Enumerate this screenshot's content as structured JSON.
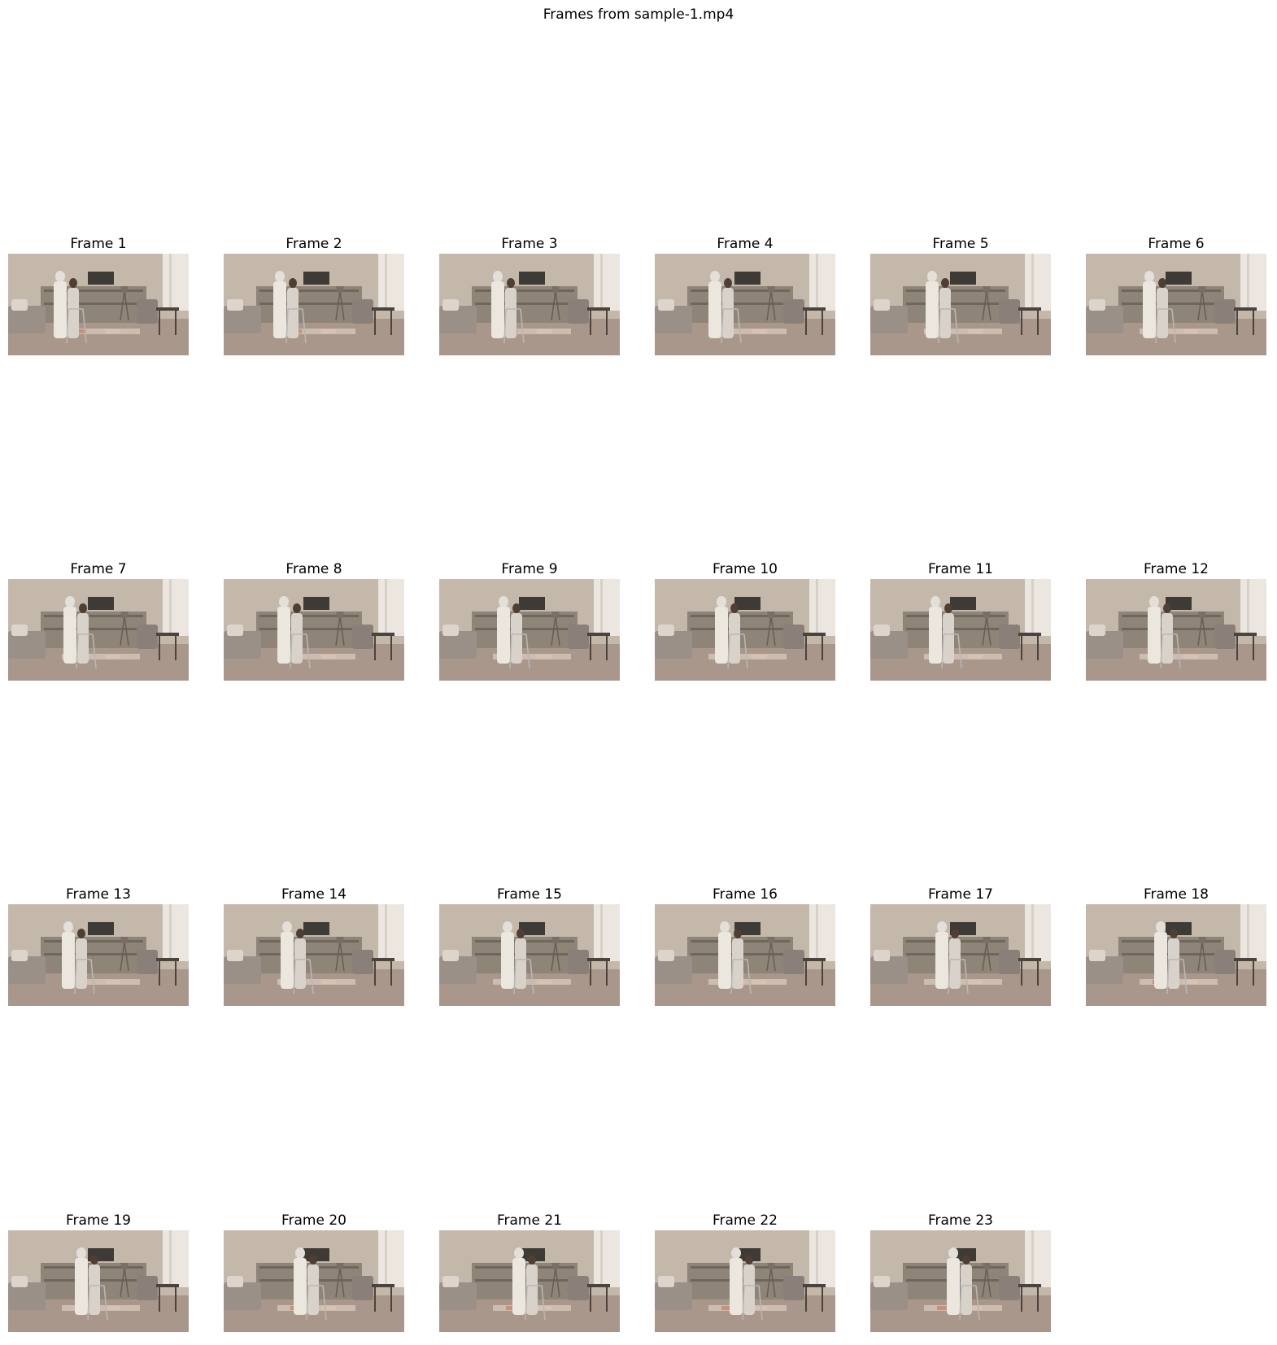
{
  "title": "Frames from sample-1.mp4",
  "frames": [
    {
      "label": "Frame 1"
    },
    {
      "label": "Frame 2"
    },
    {
      "label": "Frame 3"
    },
    {
      "label": "Frame 4"
    },
    {
      "label": "Frame 5"
    },
    {
      "label": "Frame 6"
    },
    {
      "label": "Frame 7"
    },
    {
      "label": "Frame 8"
    },
    {
      "label": "Frame 9"
    },
    {
      "label": "Frame 10"
    },
    {
      "label": "Frame 11"
    },
    {
      "label": "Frame 12"
    },
    {
      "label": "Frame 13"
    },
    {
      "label": "Frame 14"
    },
    {
      "label": "Frame 15"
    },
    {
      "label": "Frame 16"
    },
    {
      "label": "Frame 17"
    },
    {
      "label": "Frame 18"
    },
    {
      "label": "Frame 19"
    },
    {
      "label": "Frame 20"
    },
    {
      "label": "Frame 21"
    },
    {
      "label": "Frame 22"
    },
    {
      "label": "Frame 23"
    }
  ]
}
